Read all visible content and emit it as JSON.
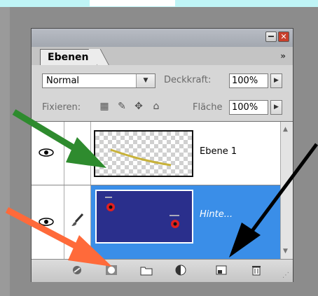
{
  "panel": {
    "tab_label": "Ebenen",
    "tab_menu": "»",
    "blend_mode": "Normal",
    "opacity_label": "Deckkraft:",
    "opacity_value": "100%",
    "lock_label": "Fixieren:",
    "fill_label": "Fläche",
    "fill_value": "100%"
  },
  "layers": [
    {
      "name": "Ebene 1",
      "visible": true,
      "selected": false
    },
    {
      "name": "Hinte...",
      "visible": true,
      "selected": true
    }
  ],
  "colors": {
    "selection": "#3a8ee8",
    "thumbnail_bg": "#2a2f8c",
    "arrow_green": "#2e8b2e",
    "arrow_orange": "#ff6a3a",
    "arrow_black": "#000000"
  },
  "icons": [
    "eye-icon",
    "brush-icon",
    "link-icon",
    "add-mask-icon",
    "new-group-icon",
    "adjustment-layer-icon",
    "new-layer-icon",
    "trash-icon"
  ]
}
